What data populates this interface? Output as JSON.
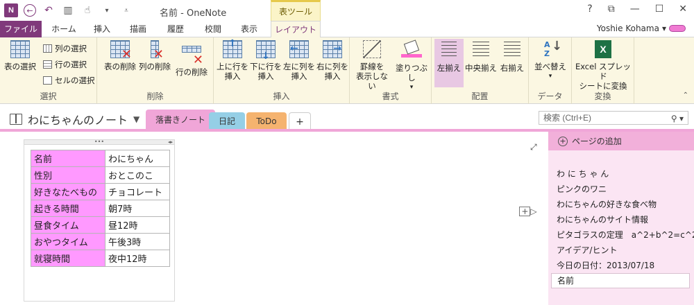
{
  "title_bar": {
    "app_logo": "N",
    "window_title": "名前 - OneNote",
    "context_tab_group": "表ツール",
    "help": "?",
    "controls": {
      "display_options": "⧉",
      "minimize": "—",
      "maximize": "☐",
      "close": "✕"
    }
  },
  "ribbon_tabs": {
    "file": "ファイル",
    "home": "ホーム",
    "insert": "挿入",
    "draw": "描画",
    "history": "履歴",
    "review": "校閲",
    "view": "表示",
    "layout": "レイアウト"
  },
  "user": {
    "name": "Yoshie Kohama",
    "caret": "▾"
  },
  "ribbon": {
    "select_group": {
      "label": "選択",
      "select_table": "表の選択",
      "select_columns": "列の選択",
      "select_rows": "行の選択",
      "select_cell": "セルの選択"
    },
    "delete_group": {
      "label": "削除",
      "delete_table": "表の削除",
      "delete_columns": "列の削除",
      "delete_rows": "行の削除"
    },
    "insert_group": {
      "label": "挿入",
      "insert_above": "上に行を\n挿入",
      "insert_below": "下に行を\n挿入",
      "insert_left": "左に列を\n挿入",
      "insert_right": "右に列を\n挿入"
    },
    "format_group": {
      "label": "書式",
      "hide_borders": "罫線を\n表示しない",
      "shading": "塗りつぶし"
    },
    "align_group": {
      "label": "配置",
      "align_left": "左揃え",
      "align_center": "中央揃え",
      "align_right": "右揃え"
    },
    "data_group": {
      "label": "データ",
      "sort": "並べ替え"
    },
    "convert_group": {
      "label": "変換",
      "excel_convert": "Excel スプレッド\nシートに変換"
    }
  },
  "notebook": {
    "title": "わにちゃんのノート",
    "sections": [
      "落書きノート",
      "日記",
      "ToDo"
    ],
    "add_section": "+",
    "search_placeholder": "検索 (Ctrl+E)"
  },
  "table": {
    "rows": [
      [
        "名前",
        "わにちゃん"
      ],
      [
        "性別",
        "おとこのこ"
      ],
      [
        "好きなたべもの",
        "チョコレート"
      ],
      [
        "起きる時間",
        "朝7時"
      ],
      [
        "昼食タイム",
        "昼12時"
      ],
      [
        "おやつタイム",
        "午後3時"
      ],
      [
        "就寝時間",
        "夜中12時"
      ]
    ]
  },
  "page_list": {
    "add_page": "ページの追加",
    "pages": [
      "わ に ち ゃ ん",
      "ピンクのワニ",
      "わにちゃんの好きな食べ物",
      "わにちゃんのサイト情報",
      "ピタゴラスの定理　a^2+b^2=c^2",
      "アイデア/ヒント",
      "今日の日付：2013/07/18",
      "名前"
    ]
  },
  "colors": {
    "onenote_purple": "#80397B",
    "ribbon_bg": "#fbf7e2",
    "key_cell_pink": "#ff99ff",
    "section_pink": "#f0a6d8",
    "section_blue": "#95cfe6",
    "section_orange": "#f5b36f"
  }
}
